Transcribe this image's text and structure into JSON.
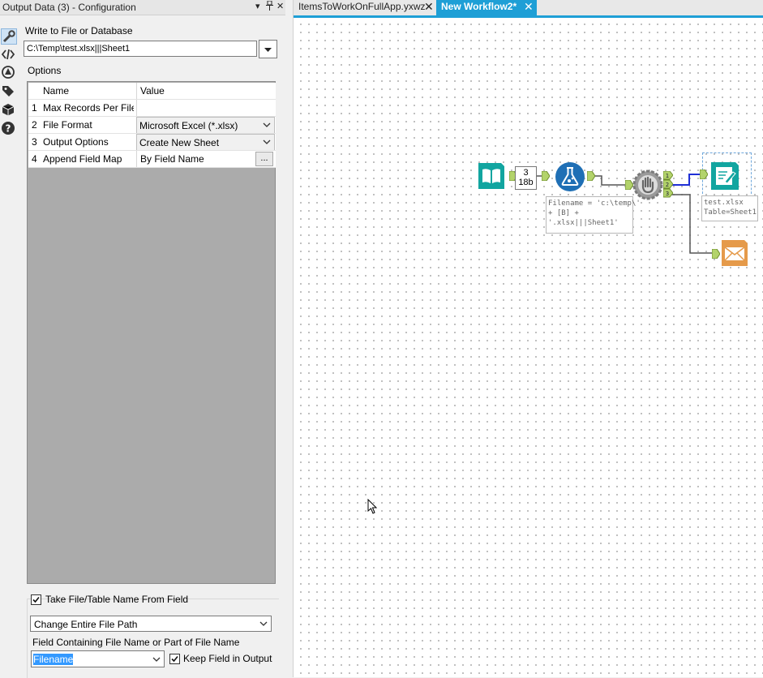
{
  "panel": {
    "title": "Output Data (3) - Configuration",
    "write_label": "Write to File or Database",
    "write_value": "C:\\Temp\\test.xlsx|||Sheet1",
    "options_label": "Options",
    "columns": {
      "name": "Name",
      "value": "Value"
    },
    "rows": [
      {
        "num": "1",
        "name": "Max Records Per File",
        "value": ""
      },
      {
        "num": "2",
        "name": "File Format",
        "value": "Microsoft Excel (*.xlsx)"
      },
      {
        "num": "3",
        "name": "Output Options",
        "value": "Create New Sheet"
      },
      {
        "num": "4",
        "name": "Append Field Map",
        "value": "By Field Name",
        "button": "..."
      }
    ],
    "take_name_label": "Take File/Table Name From Field",
    "change_mode": "Change Entire File Path",
    "field_label": "Field Containing File Name or Part of File Name",
    "field_value": "Filename",
    "keep_field_label": "Keep Field in Output"
  },
  "tabs": [
    {
      "label": "ItemsToWorkOnFullApp.yxwz",
      "active": false
    },
    {
      "label": "New Workflow2*",
      "active": true
    }
  ],
  "workflow": {
    "record_count": "3",
    "record_size": "18b",
    "formula_annotation": [
      "Filename = 'c:\\temp\\'",
      "+ [B] +",
      "'.xlsx|||Sheet1'"
    ],
    "output_annotation": [
      "test.xlsx",
      "Table=Sheet1"
    ],
    "anchors": [
      "1",
      "2",
      "3"
    ]
  },
  "colors": {
    "accent": "#1e9fd6",
    "input_tool": "#12a5a0",
    "formula_tool": "#1f6fb5",
    "output_tool": "#12a5a0",
    "email_tool": "#e59a4a"
  }
}
